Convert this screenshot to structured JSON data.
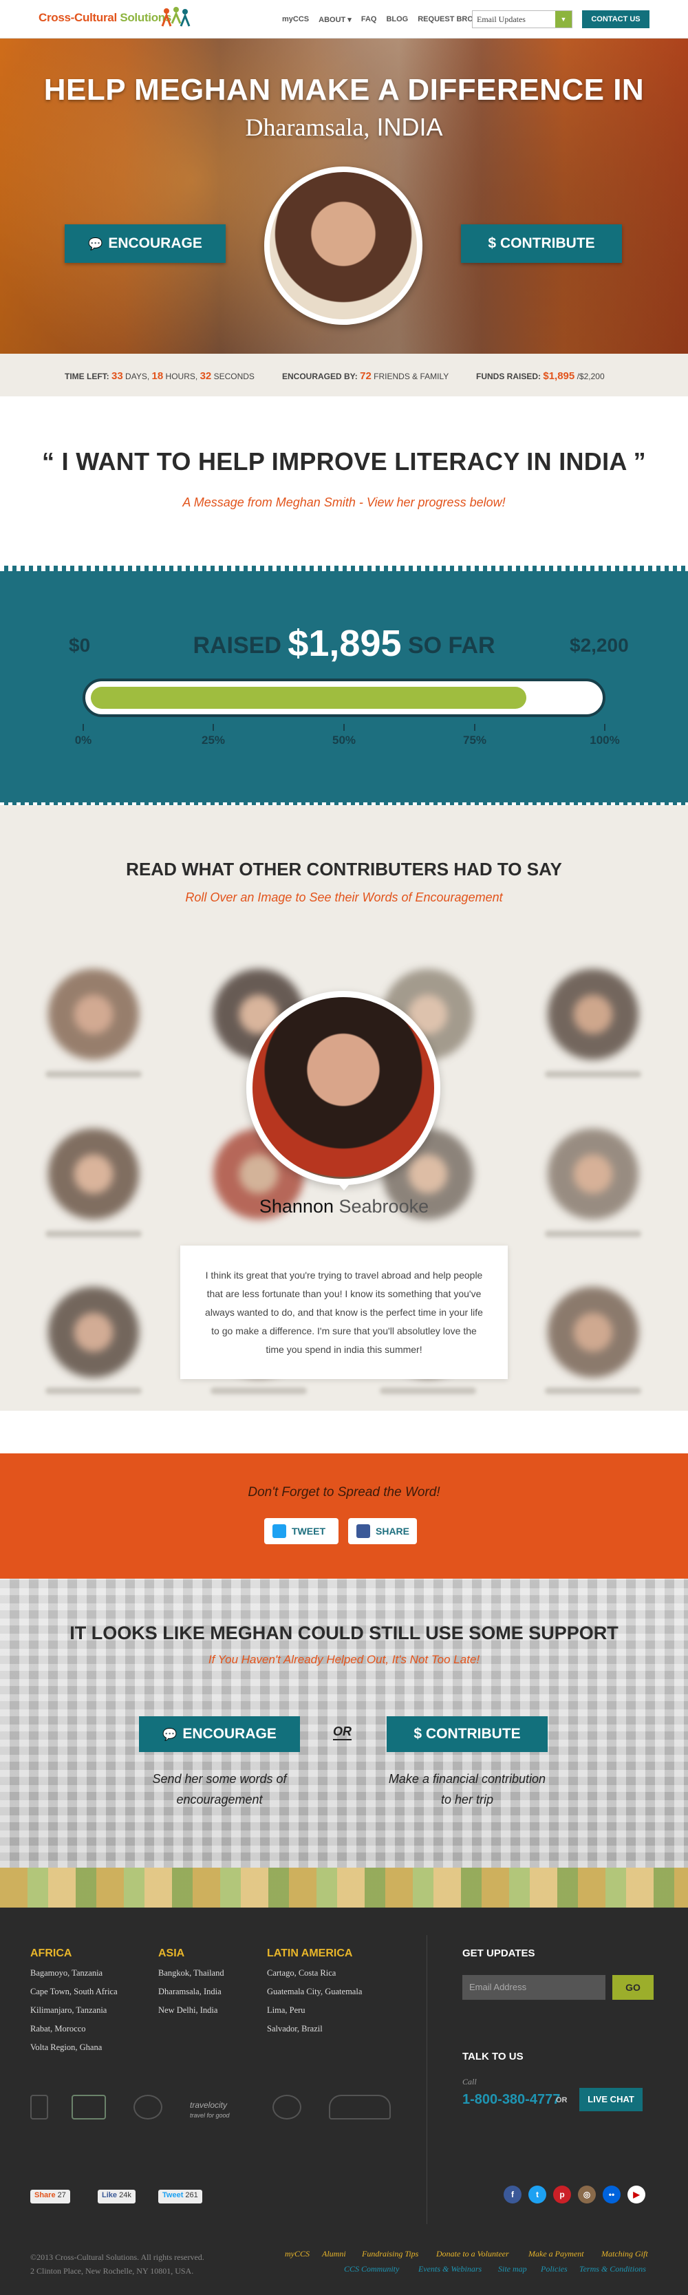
{
  "header": {
    "logo_text": "Cross-Cultural",
    "logo_text2": "Solutions",
    "nav": [
      "myCCS",
      "ABOUT",
      "FAQ",
      "BLOG",
      "REQUEST BROCHURE"
    ],
    "email_select": "Email Updates",
    "contact_label": "CONTACT US"
  },
  "hero": {
    "title": "HELP MEGHAN MAKE A DIFFERENCE IN",
    "location_city": "Dharamsala,",
    "location_country": "INDIA",
    "encourage_label": "ENCOURAGE",
    "contribute_label": "CONTRIBUTE"
  },
  "stats": {
    "time_label": "TIME LEFT:",
    "days": "33",
    "days_unit": "DAYS,",
    "hours": "18",
    "hours_unit": "HOURS,",
    "seconds": "32",
    "seconds_unit": "SECONDS",
    "encouraged_label": "ENCOURAGED BY:",
    "encouraged_count": "72",
    "encouraged_unit": "FRIENDS & FAMILY",
    "funds_label": "FUNDS RAISED:",
    "funds_raised": "$1,895",
    "funds_goal": "/$2,200"
  },
  "quote": {
    "text": "“ I WANT TO HELP IMPROVE LITERACY IN INDIA ”",
    "sub": "A Message from Meghan Smith - View her progress below!"
  },
  "progress": {
    "min_label": "$0",
    "max_label": "$2,200",
    "raised_prefix": "RAISED",
    "raised_amount": "$1,895",
    "raised_suffix": "SO FAR",
    "fraction": 0.86,
    "ticks": [
      "0%",
      "25%",
      "50%",
      "75%",
      "100%"
    ],
    "colors": {
      "band": "#1d6f7f",
      "fill": "#9fbd3f"
    }
  },
  "contributors": {
    "title": "READ WHAT OTHER CONTRIBUTERS HAD TO SAY",
    "sub": "Roll Over an Image to See their Words of Encouragement",
    "featured_first": "Shannon",
    "featured_last": "Seabrooke",
    "featured_message": "I think its great that you're trying to travel abroad and help people that are less fortunate than you! I know its something that you've always wanted to do, and that know is the perfect time in your life to go make a difference. I'm sure that you'll absolutley love the time you spend in india this summer!"
  },
  "spread": {
    "title": "Don't Forget to Spread the Word!",
    "tweet_label": "TWEET",
    "share_label": "SHARE"
  },
  "support": {
    "title": "IT LOOKS LIKE MEGHAN COULD STILL USE SOME SUPPORT",
    "sub": "If You Haven't Already Helped Out, It's Not Too Late!",
    "encourage_label": "ENCOURAGE",
    "contribute_label": "CONTRIBUTE",
    "or_label": "OR",
    "encourage_text": "Send her some words of encouragement",
    "contribute_text": "Make a financial contribution to her trip"
  },
  "footer": {
    "africa": {
      "title": "AFRICA",
      "items": [
        "Bagamoyo, Tanzania",
        "Cape Town, South Africa",
        "Kilimanjaro, Tanzania",
        "Rabat, Morocco",
        "Volta Region, Ghana"
      ]
    },
    "asia": {
      "title": "ASIA",
      "items": [
        "Bangkok, Thailand",
        "Dharamsala, India",
        "New Delhi, India"
      ]
    },
    "latin": {
      "title": "LATIN AMERICA",
      "items": [
        "Cartago, Costa Rica",
        "Guatemala City, Guatemala",
        "Lima, Peru",
        "Salvador, Brazil"
      ]
    },
    "updates_title": "GET UPDATES",
    "email_placeholder": "Email Address",
    "go_label": "GO",
    "talk_title": "TALK TO US",
    "call_label": "Call",
    "phone": "1-800-380-4777",
    "or_label": "OR",
    "live_chat": "LIVE CHAT",
    "share_counts": {
      "share": "27",
      "like": "24k",
      "tweet": "261"
    },
    "share_labels": {
      "share": "Share",
      "like": "Like",
      "tweet": "Tweet"
    },
    "copyright": "©2013 Cross-Cultural Solutions. All rights reserved.",
    "address": "2 Clinton Place, New Rochelle, NY 10801, USA.",
    "links_row1": [
      "myCCS",
      "Alumni",
      "Fundraising Tips",
      "Donate to a Volunteer",
      "Make a Payment",
      "Matching Gift"
    ],
    "links_row2": [
      "CCS Community",
      "Events & Webinars",
      "Site map",
      "Policies",
      "Terms & Conditions"
    ],
    "logo_travelocity": "travelocity",
    "logo_travelocity_sub": "travel for good"
  }
}
